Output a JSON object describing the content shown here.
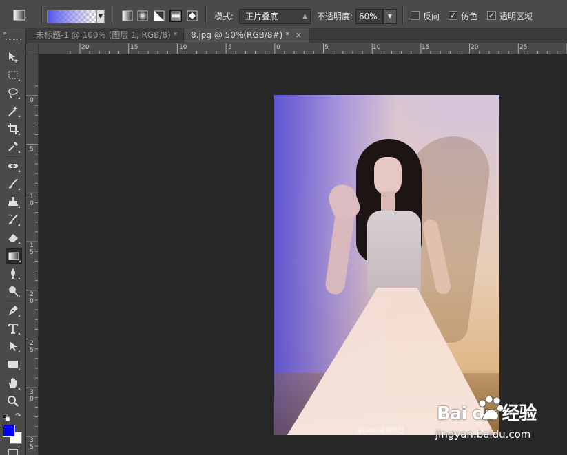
{
  "options_bar": {
    "mode_label": "模式:",
    "mode_value": "正片叠底",
    "opacity_label": "不透明度:",
    "opacity_value": "60%",
    "reverse_label": "反向",
    "reverse_checked": false,
    "dither_label": "仿色",
    "dither_checked": true,
    "transparency_label": "透明区域",
    "transparency_checked": true,
    "gradient_types": [
      "linear-gradient-icon",
      "radial-gradient-icon",
      "angle-gradient-icon",
      "reflected-gradient-icon",
      "diamond-gradient-icon"
    ],
    "active_gradient_type": "reflected-gradient-icon"
  },
  "tabs": [
    {
      "label": "未标题-1 @ 100% (图层 1, RGB/8) *",
      "close": "×",
      "active": false
    },
    {
      "label": "8.jpg @ 50%(RGB/8#) *",
      "close": "×",
      "active": true
    }
  ],
  "hruler_labels": [
    "20",
    "15",
    "10",
    "5",
    "0",
    "5",
    "10",
    "15",
    "20",
    "25"
  ],
  "vruler_labels": [
    "0",
    "5",
    "10",
    "15",
    "20",
    "25",
    "30",
    "35"
  ],
  "tools": [
    "move-tool-icon",
    "marquee-tool-icon",
    "lasso-tool-icon",
    "magic-wand-icon",
    "crop-tool-icon",
    "eyedropper-icon",
    "healing-brush-icon",
    "brush-tool-icon",
    "clone-stamp-icon",
    "history-brush-icon",
    "eraser-icon",
    "gradient-tool-icon",
    "blur-tool-icon",
    "dodge-tool-icon",
    "pen-tool-icon",
    "type-tool-icon",
    "path-selection-icon",
    "rectangle-tool-icon",
    "hand-tool-icon",
    "zoom-tool-icon"
  ],
  "active_tool": "gradient-tool-icon",
  "foreground_color": "#0000ff",
  "background_color": "#ffffff",
  "photo": {
    "watermark": "@Dear-迪丽热巴"
  },
  "baidu": {
    "brand": "Bai du 经验",
    "site": "jingyan.baidu.com"
  }
}
